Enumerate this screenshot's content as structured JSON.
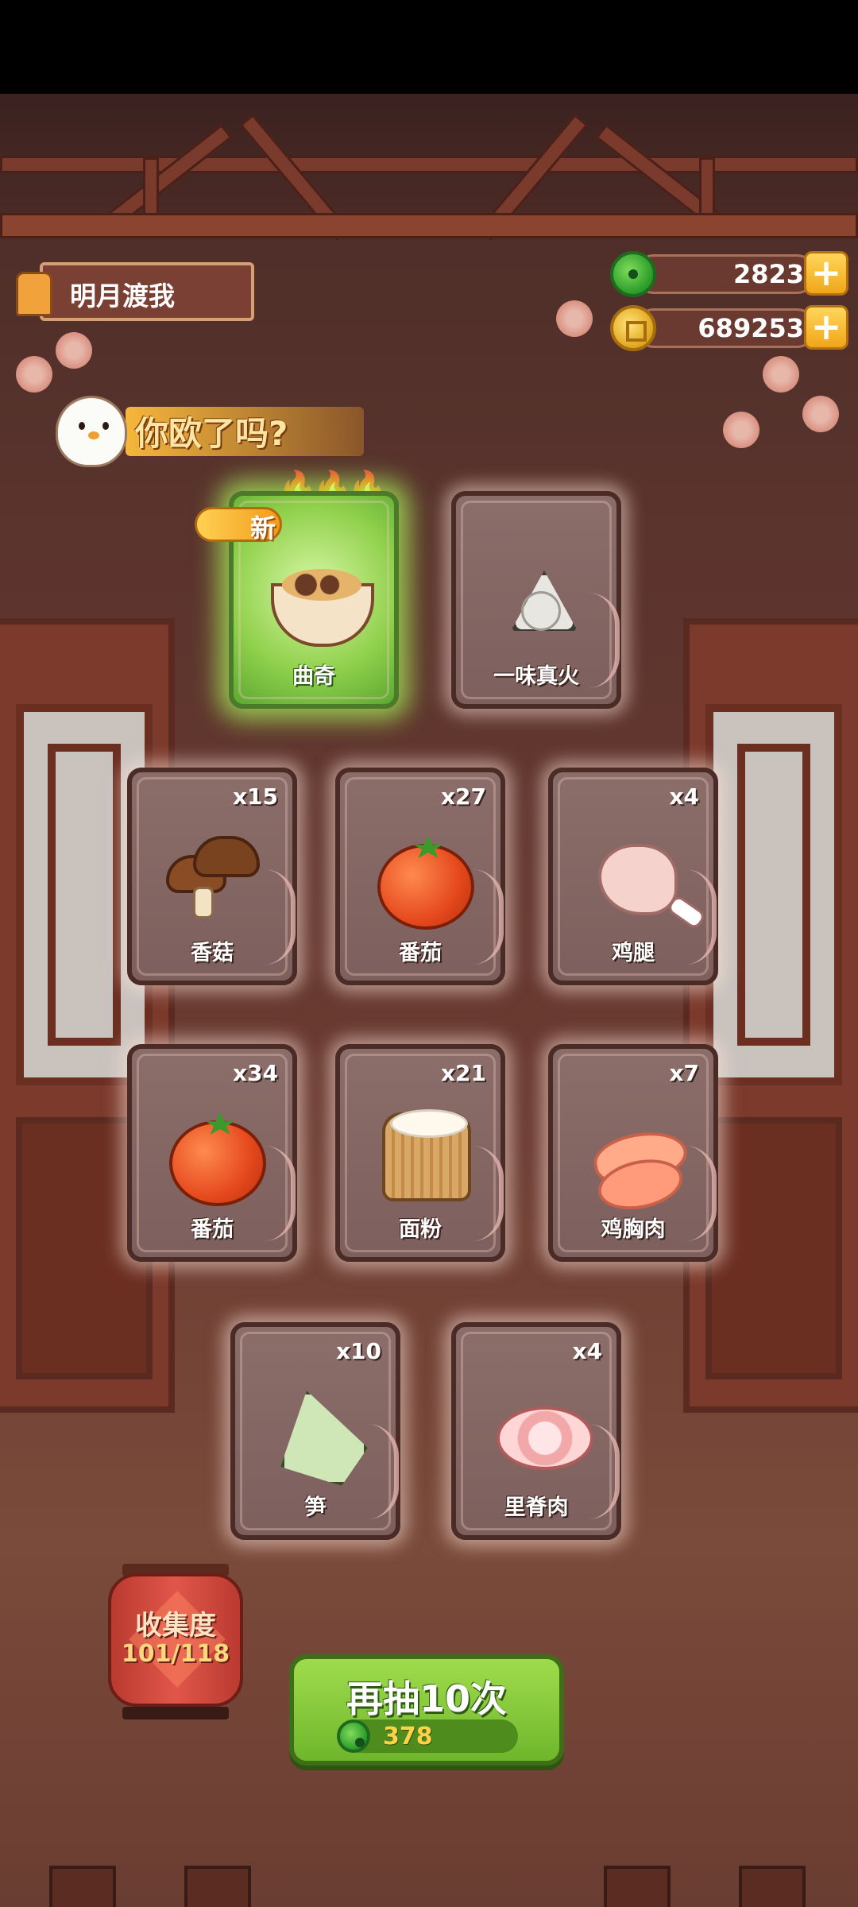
{
  "player": {
    "name": "明月渡我"
  },
  "currencies": [
    {
      "type": "jade",
      "icon": "jade-icon",
      "amount": "2823"
    },
    {
      "type": "coin",
      "icon": "coin-icon",
      "amount": "689253"
    }
  ],
  "banner": {
    "text": "你欧了吗?"
  },
  "new_badge": "新",
  "featured_cards": [
    {
      "name": "曲奇",
      "icon": "dish-bowl-icon",
      "style": "green",
      "is_new": true,
      "rarity_flames": 3
    },
    {
      "name": "一味真火",
      "icon": "rice-ball-icon",
      "style": "normal"
    }
  ],
  "item_cards": [
    {
      "name": "香菇",
      "count": "x15",
      "icon": "mushroom-icon"
    },
    {
      "name": "番茄",
      "count": "x27",
      "icon": "tomato-icon"
    },
    {
      "name": "鸡腿",
      "count": "x4",
      "icon": "chicken-leg-icon"
    },
    {
      "name": "番茄",
      "count": "x34",
      "icon": "tomato-icon"
    },
    {
      "name": "面粉",
      "count": "x21",
      "icon": "flour-sack-icon"
    },
    {
      "name": "鸡胸肉",
      "count": "x7",
      "icon": "chicken-breast-icon"
    },
    {
      "name": "笋",
      "count": "x10",
      "icon": "bamboo-shoot-icon"
    },
    {
      "name": "里脊肉",
      "count": "x4",
      "icon": "pork-loin-icon"
    }
  ],
  "collection": {
    "title": "收集度",
    "value": "101/118"
  },
  "draw_button": {
    "label": "再抽10次",
    "cost": "378",
    "cost_icon": "jade-icon"
  },
  "colors": {
    "card_border": "#4a2b26",
    "accent_green": "#6fb62c",
    "gold": "#ffd24a"
  }
}
